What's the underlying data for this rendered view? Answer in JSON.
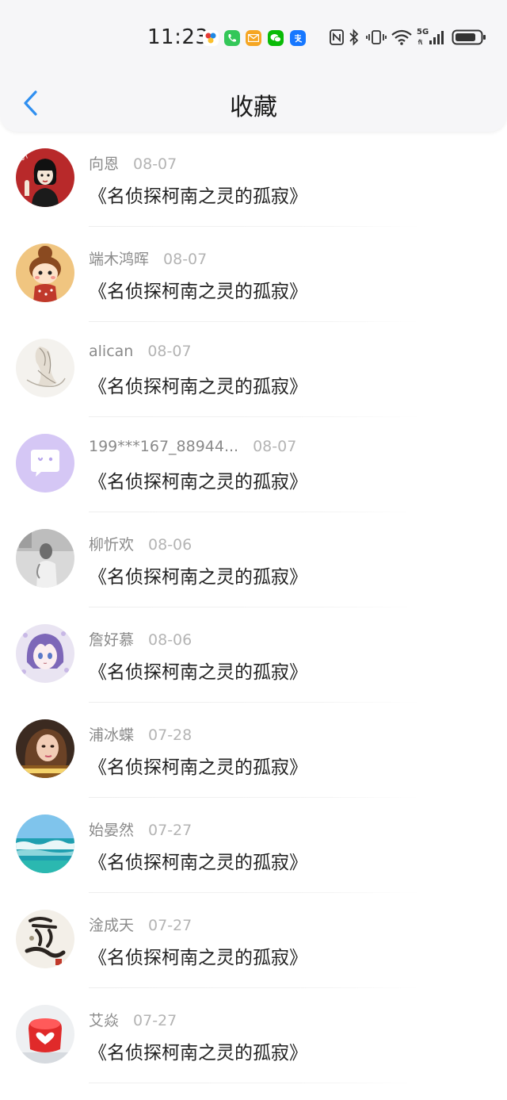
{
  "status_bar": {
    "time": "11:23",
    "network_label": "5G"
  },
  "nav": {
    "title": "收藏"
  },
  "favorites": [
    {
      "user": "向恩",
      "date": "08-07",
      "book": "《名侦探柯南之灵的孤寂》",
      "avatar_icon": "girl-cartoon-avatar"
    },
    {
      "user": "端木鸿晖",
      "date": "08-07",
      "book": "《名侦探柯南之灵的孤寂》",
      "avatar_icon": "doll-avatar"
    },
    {
      "user": "alican",
      "date": "08-07",
      "book": "《名侦探柯南之灵的孤寂》",
      "avatar_icon": "sketch-avatar"
    },
    {
      "user": "199***167_88944...",
      "date": "08-07",
      "book": "《名侦探柯南之灵的孤寂》",
      "avatar_icon": "default-chat-avatar"
    },
    {
      "user": "柳忻欢",
      "date": "08-06",
      "book": "《名侦探柯南之灵的孤寂》",
      "avatar_icon": "photo-avatar"
    },
    {
      "user": "詹好慕",
      "date": "08-06",
      "book": "《名侦探柯南之灵的孤寂》",
      "avatar_icon": "anime-avatar"
    },
    {
      "user": "浦冰蝶",
      "date": "07-28",
      "book": "《名侦探柯南之灵的孤寂》",
      "avatar_icon": "portrait-avatar"
    },
    {
      "user": "始晏然",
      "date": "07-27",
      "book": "《名侦探柯南之灵的孤寂》",
      "avatar_icon": "sea-avatar"
    },
    {
      "user": "淦成天",
      "date": "07-27",
      "book": "《名侦探柯南之灵的孤寂》",
      "avatar_icon": "calligraphy-avatar"
    },
    {
      "user": "艾焱",
      "date": "07-27",
      "book": "《名侦探柯南之灵的孤寂》",
      "avatar_icon": "heart-cup-avatar"
    }
  ],
  "colors": {
    "accent": "#2f8ff0",
    "header_bg": "#f6f6f8",
    "username": "#8a8a8a",
    "date": "#b4b4b4"
  }
}
